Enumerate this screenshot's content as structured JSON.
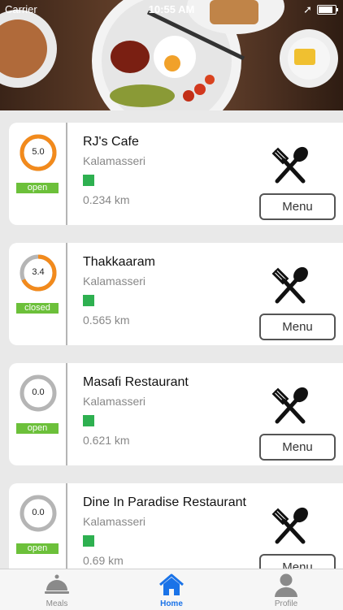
{
  "status_bar": {
    "carrier": "Carrier",
    "time": "10:55 AM"
  },
  "restaurants": [
    {
      "name": "RJ's Cafe",
      "location": "Kalamasseri",
      "rating": "5.0",
      "rating_fraction": 1.0,
      "status": "open",
      "distance": "0.234 km",
      "menu_label": "Menu"
    },
    {
      "name": "Thakkaaram",
      "location": "Kalamasseri",
      "rating": "3.4",
      "rating_fraction": 0.68,
      "status": "closed",
      "distance": "0.565 km",
      "menu_label": "Menu"
    },
    {
      "name": "Masafi Restaurant",
      "location": "Kalamasseri",
      "rating": "0.0",
      "rating_fraction": 0.0,
      "status": "open",
      "distance": "0.621 km",
      "menu_label": "Menu"
    },
    {
      "name": "Dine In Paradise Restaurant",
      "location": "Kalamasseri",
      "rating": "0.0",
      "rating_fraction": 0.0,
      "status": "open",
      "distance": "0.69 km",
      "menu_label": "Menu"
    }
  ],
  "tabs": [
    {
      "label": "Meals",
      "icon": "cloche-icon",
      "active": false
    },
    {
      "label": "Home",
      "icon": "home-icon",
      "active": true
    },
    {
      "label": "Profile",
      "icon": "person-icon",
      "active": false
    }
  ],
  "colors": {
    "rating_ring": "#f28a1c",
    "ring_track": "#b5b5b5",
    "status_badge": "#6cc03a",
    "indicator": "#2eb050",
    "active_tab": "#1a73e8"
  }
}
